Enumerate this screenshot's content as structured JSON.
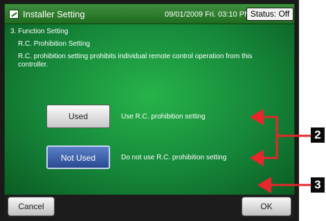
{
  "header": {
    "title": "Installer Setting",
    "icon": "edit-icon",
    "datetime": "09/01/2009 Fri. 03:10 PM",
    "status": "Status: Off"
  },
  "content": {
    "section_title": "3. Function Setting",
    "subsection_title": "R.C. Prohibition Setting",
    "description": "R.C. prohibition setting prohibits individual remote control operation from this controller.",
    "options": [
      {
        "label": "Used",
        "description": "Use R.C. prohibition setting",
        "selected": false
      },
      {
        "label": "Not Used",
        "description": "Do not use R.C. prohibition setting",
        "selected": true
      }
    ]
  },
  "footer": {
    "cancel_label": "Cancel",
    "ok_label": "OK"
  },
  "callouts": {
    "options": "2",
    "ok": "3"
  },
  "colors": {
    "accent_green": "#16873a",
    "selected_blue": "#2a4a92",
    "callout_red": "#e8262b"
  }
}
